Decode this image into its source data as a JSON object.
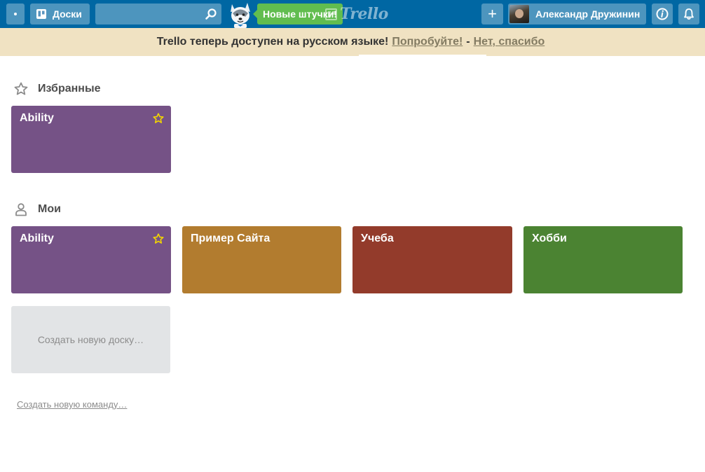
{
  "header": {
    "boards_label": "Доски",
    "search": {
      "value": "",
      "placeholder": ""
    },
    "new_stuff_label": "Новые штучки!",
    "logo_text": "Trello",
    "add_label": "+",
    "user_name": "Александр Дружинин",
    "info_icon": "info-icon",
    "bell_icon": "bell-icon",
    "color": "#0067a3"
  },
  "banner": {
    "text": "Trello теперь доступен на русском языке!",
    "try_link": "Попробуйте!",
    "separator": "-",
    "no_thanks_link": "Нет, спасибо",
    "background": "#f0e2c2"
  },
  "favorites": {
    "title": "Избранные",
    "icon": "star-icon",
    "boards": [
      {
        "name": "Ability",
        "color": "#755286",
        "starred": true
      }
    ]
  },
  "mine": {
    "title": "Мои",
    "icon": "person-icon",
    "boards": [
      {
        "name": "Ability",
        "color": "#755286",
        "starred": true
      },
      {
        "name": "Пример Сайта",
        "color": "#b27c2f",
        "starred": false
      },
      {
        "name": "Учеба",
        "color": "#933b2b",
        "starred": false
      },
      {
        "name": "Хобби",
        "color": "#4b8332",
        "starred": false
      }
    ],
    "create_board_label": "Создать новую доску…"
  },
  "create_team_label": "Создать новую команду…"
}
